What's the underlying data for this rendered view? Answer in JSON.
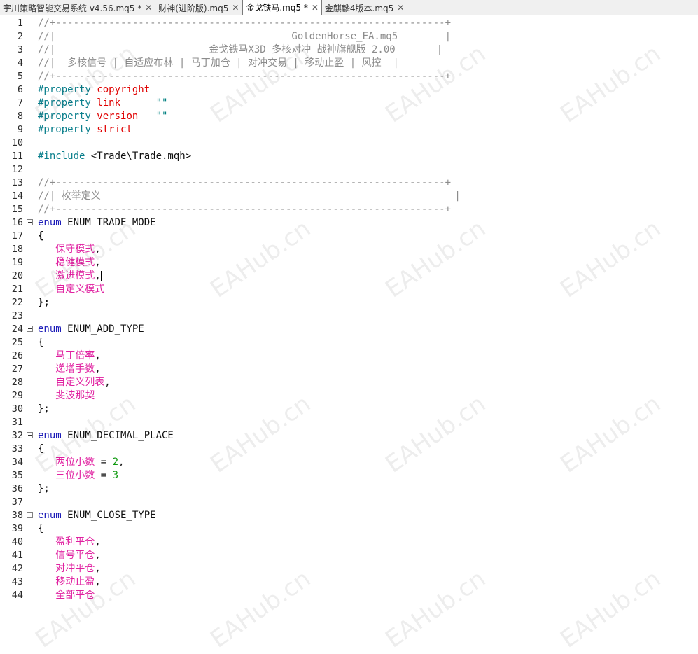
{
  "tabs": [
    {
      "label": "宇川策略智能交易系统 v4.56.mq5 *",
      "active": false
    },
    {
      "label": "财神(进阶版).mq5",
      "active": false
    },
    {
      "label": "金戈铁马.mq5 *",
      "active": true
    },
    {
      "label": "金麒麟4版本.mq5",
      "active": false
    }
  ],
  "close_glyph": "✕",
  "watermark": "EAHub.cn",
  "lines": [
    {
      "n": "1",
      "t": [
        [
          "c-comment",
          "//+------------------------------------------------------------------+"
        ]
      ]
    },
    {
      "n": "2",
      "t": [
        [
          "c-comment",
          "//|                                        GoldenHorse_EA.mq5        |"
        ]
      ]
    },
    {
      "n": "3",
      "t": [
        [
          "c-comment",
          "//|                          金戈铁马X3D 多核对冲 战神旗舰版 2.00       |"
        ]
      ]
    },
    {
      "n": "4",
      "t": [
        [
          "c-comment",
          "//|  多核信号 | 自适应布林 | 马丁加仓 | 对冲交易 | 移动止盈 | 风控  |"
        ]
      ]
    },
    {
      "n": "5",
      "t": [
        [
          "c-comment",
          "//+------------------------------------------------------------------+"
        ]
      ]
    },
    {
      "n": "6",
      "t": [
        [
          "c-pp",
          "#property "
        ],
        [
          "c-red",
          "copyright"
        ]
      ]
    },
    {
      "n": "7",
      "t": [
        [
          "c-pp",
          "#property "
        ],
        [
          "c-red",
          "link"
        ],
        [
          "c-plain",
          "      "
        ],
        [
          "c-str",
          "\"\""
        ]
      ]
    },
    {
      "n": "8",
      "t": [
        [
          "c-pp",
          "#property "
        ],
        [
          "c-red",
          "version"
        ],
        [
          "c-plain",
          "   "
        ],
        [
          "c-str",
          "\"\""
        ]
      ]
    },
    {
      "n": "9",
      "t": [
        [
          "c-pp",
          "#property "
        ],
        [
          "c-red",
          "strict"
        ]
      ]
    },
    {
      "n": "10",
      "t": []
    },
    {
      "n": "11",
      "t": [
        [
          "c-pp",
          "#include "
        ],
        [
          "c-plain",
          "<Trade\\Trade.mqh>"
        ]
      ]
    },
    {
      "n": "12",
      "t": []
    },
    {
      "n": "13",
      "t": [
        [
          "c-comment",
          "//+------------------------------------------------------------------+"
        ]
      ]
    },
    {
      "n": "14",
      "t": [
        [
          "c-comment",
          "//| 枚举定义                                                            |"
        ]
      ]
    },
    {
      "n": "15",
      "t": [
        [
          "c-comment",
          "//+------------------------------------------------------------------+"
        ]
      ]
    },
    {
      "n": "16",
      "fold": true,
      "t": [
        [
          "c-kw",
          "enum"
        ],
        [
          "c-plain",
          " ENUM_TRADE_MODE"
        ]
      ]
    },
    {
      "n": "17",
      "t": [
        [
          "c-bold",
          "{"
        ]
      ]
    },
    {
      "n": "18",
      "t": [
        [
          "c-plain",
          "   "
        ],
        [
          "c-enum",
          "保守模式"
        ],
        [
          "c-plain",
          ","
        ]
      ]
    },
    {
      "n": "19",
      "t": [
        [
          "c-plain",
          "   "
        ],
        [
          "c-enum",
          "稳健模式"
        ],
        [
          "c-plain",
          ","
        ]
      ]
    },
    {
      "n": "20",
      "caret": true,
      "t": [
        [
          "c-plain",
          "   "
        ],
        [
          "c-enum",
          "激进模式"
        ],
        [
          "c-plain",
          ","
        ]
      ]
    },
    {
      "n": "21",
      "t": [
        [
          "c-plain",
          "   "
        ],
        [
          "c-enum",
          "自定义模式"
        ]
      ]
    },
    {
      "n": "22",
      "t": [
        [
          "c-bold",
          "};"
        ]
      ]
    },
    {
      "n": "23",
      "t": []
    },
    {
      "n": "24",
      "fold": true,
      "t": [
        [
          "c-kw",
          "enum"
        ],
        [
          "c-plain",
          " ENUM_ADD_TYPE"
        ]
      ]
    },
    {
      "n": "25",
      "t": [
        [
          "c-plain",
          "{"
        ]
      ]
    },
    {
      "n": "26",
      "t": [
        [
          "c-plain",
          "   "
        ],
        [
          "c-enum",
          "马丁倍率"
        ],
        [
          "c-plain",
          ","
        ]
      ]
    },
    {
      "n": "27",
      "t": [
        [
          "c-plain",
          "   "
        ],
        [
          "c-enum",
          "递增手数"
        ],
        [
          "c-plain",
          ","
        ]
      ]
    },
    {
      "n": "28",
      "t": [
        [
          "c-plain",
          "   "
        ],
        [
          "c-enum",
          "自定义列表"
        ],
        [
          "c-plain",
          ","
        ]
      ]
    },
    {
      "n": "29",
      "t": [
        [
          "c-plain",
          "   "
        ],
        [
          "c-enum",
          "斐波那契"
        ]
      ]
    },
    {
      "n": "30",
      "t": [
        [
          "c-plain",
          "};"
        ]
      ]
    },
    {
      "n": "31",
      "t": []
    },
    {
      "n": "32",
      "fold": true,
      "t": [
        [
          "c-kw",
          "enum"
        ],
        [
          "c-plain",
          " ENUM_DECIMAL_PLACE"
        ]
      ]
    },
    {
      "n": "33",
      "t": [
        [
          "c-plain",
          "{"
        ]
      ]
    },
    {
      "n": "34",
      "t": [
        [
          "c-plain",
          "   "
        ],
        [
          "c-enum",
          "两位小数"
        ],
        [
          "c-plain",
          " = "
        ],
        [
          "c-num",
          "2"
        ],
        [
          "c-plain",
          ","
        ]
      ]
    },
    {
      "n": "35",
      "t": [
        [
          "c-plain",
          "   "
        ],
        [
          "c-enum",
          "三位小数"
        ],
        [
          "c-plain",
          " = "
        ],
        [
          "c-num",
          "3"
        ]
      ]
    },
    {
      "n": "36",
      "t": [
        [
          "c-plain",
          "};"
        ]
      ]
    },
    {
      "n": "37",
      "t": []
    },
    {
      "n": "38",
      "fold": true,
      "t": [
        [
          "c-kw",
          "enum"
        ],
        [
          "c-plain",
          " ENUM_CLOSE_TYPE"
        ]
      ]
    },
    {
      "n": "39",
      "t": [
        [
          "c-plain",
          "{"
        ]
      ]
    },
    {
      "n": "40",
      "t": [
        [
          "c-plain",
          "   "
        ],
        [
          "c-enum",
          "盈利平仓"
        ],
        [
          "c-plain",
          ","
        ]
      ]
    },
    {
      "n": "41",
      "t": [
        [
          "c-plain",
          "   "
        ],
        [
          "c-enum",
          "信号平仓"
        ],
        [
          "c-plain",
          ","
        ]
      ]
    },
    {
      "n": "42",
      "t": [
        [
          "c-plain",
          "   "
        ],
        [
          "c-enum",
          "对冲平仓"
        ],
        [
          "c-plain",
          ","
        ]
      ]
    },
    {
      "n": "43",
      "t": [
        [
          "c-plain",
          "   "
        ],
        [
          "c-enum",
          "移动止盈"
        ],
        [
          "c-plain",
          ","
        ]
      ]
    },
    {
      "n": "44",
      "t": [
        [
          "c-plain",
          "   "
        ],
        [
          "c-enum",
          "全部平仓"
        ]
      ]
    }
  ]
}
